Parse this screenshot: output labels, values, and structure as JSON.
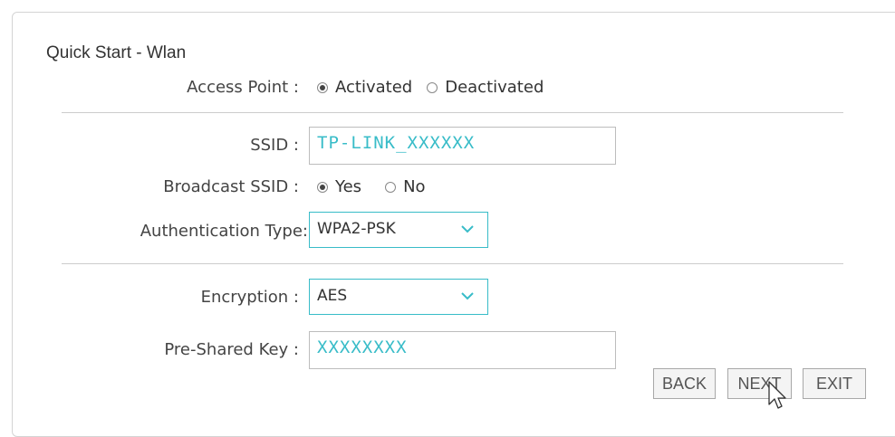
{
  "page": {
    "title": "Quick Start - Wlan"
  },
  "access_point": {
    "label": "Access Point :",
    "options": [
      "Activated",
      "Deactivated"
    ],
    "selected": "Activated"
  },
  "ssid": {
    "label": "SSID :",
    "value": "TP-LINK_XXXXXX"
  },
  "broadcast_ssid": {
    "label": "Broadcast SSID :",
    "options": [
      "Yes",
      "No"
    ],
    "selected": "Yes"
  },
  "authentication": {
    "label": "Authentication Type:",
    "value": "WPA2-PSK"
  },
  "encryption": {
    "label": "Encryption :",
    "value": "AES"
  },
  "pre_shared_key": {
    "label": "Pre-Shared Key :",
    "value": "XXXXXXXX"
  },
  "buttons": {
    "back": "BACK",
    "next": "NEXT",
    "exit": "EXIT"
  },
  "colors": {
    "accent": "#38bcc8",
    "border": "#bdbdbd"
  },
  "icons": {
    "dropdown": "chevron-down-icon",
    "cursor": "mouse-pointer-icon"
  }
}
